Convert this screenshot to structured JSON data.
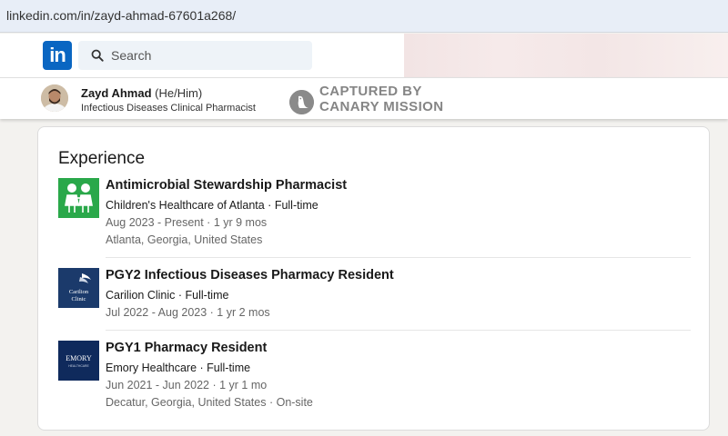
{
  "browser": {
    "url": "linkedin.com/in/zayd-ahmad-67601a268/"
  },
  "nav": {
    "logo_text": "in",
    "search_placeholder": "Search"
  },
  "profile": {
    "name": "Zayd Ahmad",
    "pronouns": "(He/Him)",
    "headline": "Infectious Diseases Clinical Pharmacist"
  },
  "watermark": {
    "line1": "CAPTURED BY",
    "line2": "CANARY MISSION"
  },
  "experience": {
    "heading": "Experience",
    "items": [
      {
        "title": "Antimicrobial Stewardship Pharmacist",
        "company": "Children's Healthcare of Atlanta · Full-time",
        "dates": "Aug 2023 - Present · 1 yr 9 mos",
        "location": "Atlanta, Georgia, United States",
        "logo_color": "#2aa84a"
      },
      {
        "title": "PGY2 Infectious Diseases Pharmacy Resident",
        "company": "Carilion Clinic · Full-time",
        "dates": "Jul 2022 - Aug 2023 · 1 yr 2 mos",
        "logo_line1": "Carilion",
        "logo_line2": "Clinic",
        "logo_color": "#1b3a6b"
      },
      {
        "title": "PGY1 Pharmacy Resident",
        "company": "Emory Healthcare · Full-time",
        "dates": "Jun 2021 - Jun 2022 · 1 yr 1 mo",
        "location": "Decatur, Georgia, United States · On-site",
        "logo_line1": "EMORY",
        "logo_line2": "HEALTHCARE",
        "logo_color": "#0f2a5c"
      }
    ]
  }
}
